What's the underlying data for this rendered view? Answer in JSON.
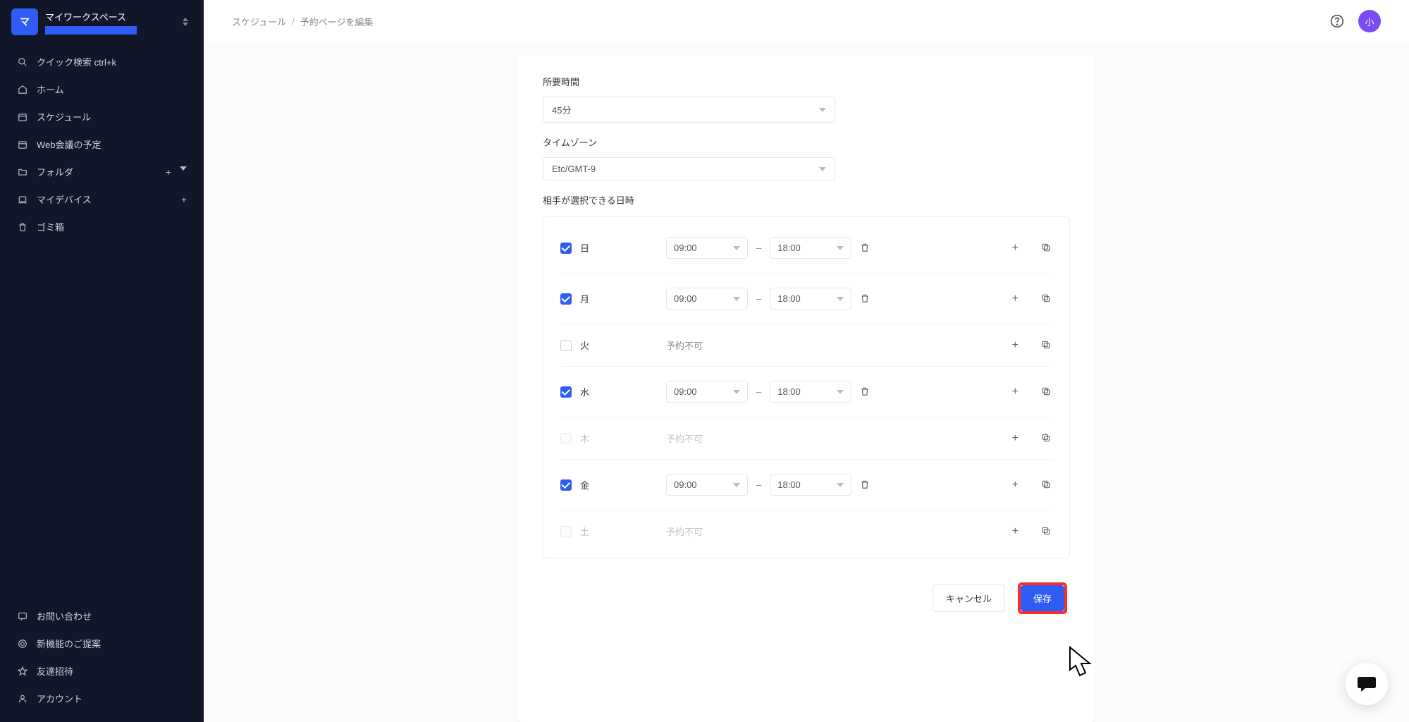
{
  "workspace": {
    "badge": "マ",
    "name": "マイワークスペース"
  },
  "sidebar": {
    "quick_search": "クイック検索 ctrl+k",
    "home": "ホーム",
    "schedule": "スケジュール",
    "web_meeting": "Web会議の予定",
    "folder": "フォルダ",
    "my_device": "マイデバイス",
    "trash": "ゴミ箱",
    "contact": "お問い合わせ",
    "new_features": "新機能のご提案",
    "invite": "友達招待",
    "account": "アカウント"
  },
  "breadcrumb": {
    "parent": "スケジュール",
    "current": "予約ページを編集"
  },
  "avatar": "小",
  "form": {
    "duration_label": "所要時間",
    "duration_value": "45分",
    "timezone_label": "タイムゾーン",
    "timezone_value": "Etc/GMT-9",
    "availability_label": "相手が選択できる日時",
    "unavailable_text": "予約不可",
    "days": [
      {
        "name": "日",
        "checked": true,
        "dim": false,
        "start": "09:00",
        "end": "18:00"
      },
      {
        "name": "月",
        "checked": true,
        "dim": false,
        "start": "09:00",
        "end": "18:00"
      },
      {
        "name": "火",
        "checked": false,
        "dim": false
      },
      {
        "name": "水",
        "checked": true,
        "dim": false,
        "start": "09:00",
        "end": "18:00"
      },
      {
        "name": "木",
        "checked": false,
        "dim": true
      },
      {
        "name": "金",
        "checked": true,
        "dim": false,
        "start": "09:00",
        "end": "18:00"
      },
      {
        "name": "土",
        "checked": false,
        "dim": true
      }
    ]
  },
  "buttons": {
    "cancel": "キャンセル",
    "save": "保存"
  }
}
